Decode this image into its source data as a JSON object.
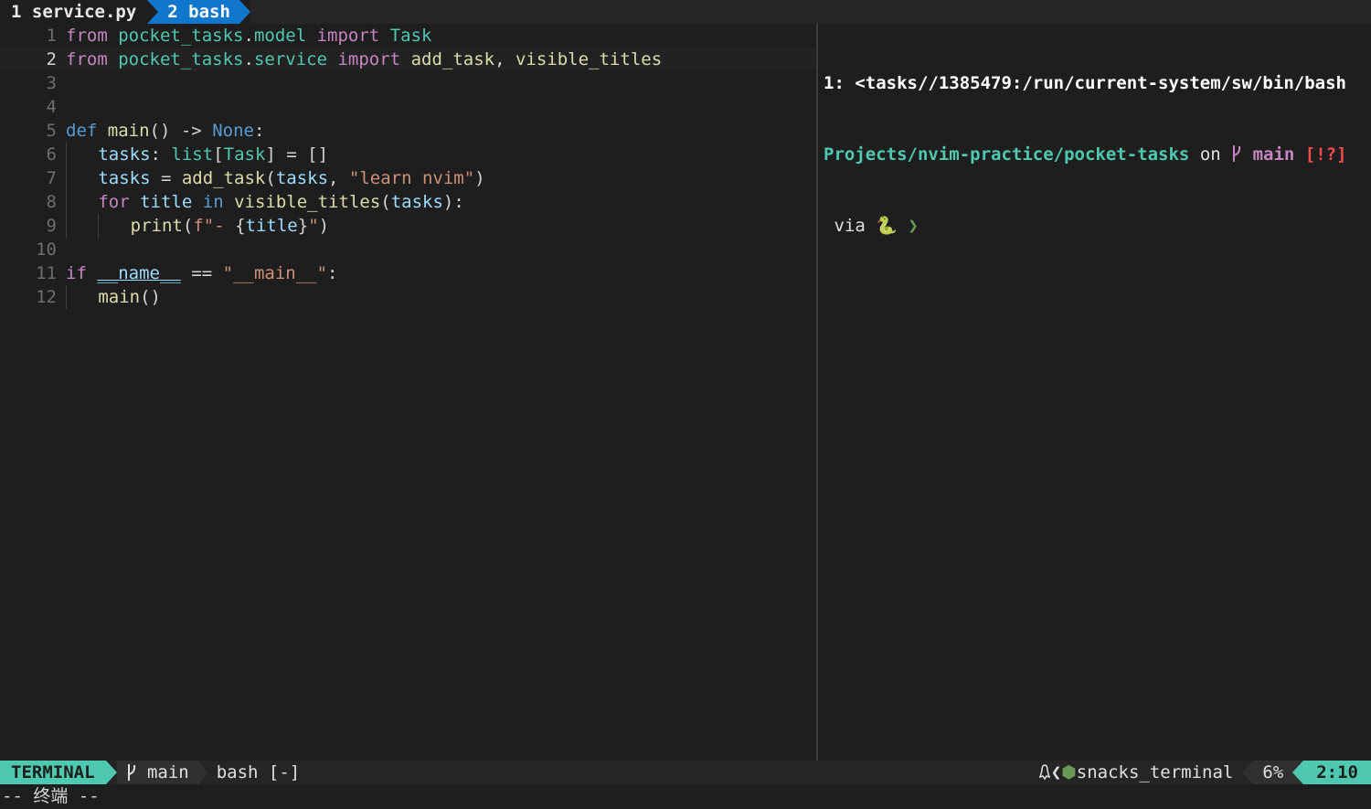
{
  "tabline": {
    "tabs": [
      {
        "label": "1 service.py",
        "active": false
      },
      {
        "label": "2 bash",
        "active": true
      }
    ]
  },
  "editor": {
    "lines": [
      {
        "num": "1"
      },
      {
        "num": "2"
      },
      {
        "num": "3"
      },
      {
        "num": "4"
      },
      {
        "num": "5"
      },
      {
        "num": "6"
      },
      {
        "num": "7"
      },
      {
        "num": "8"
      },
      {
        "num": "9"
      },
      {
        "num": "10"
      },
      {
        "num": "11"
      },
      {
        "num": "12"
      }
    ],
    "tokens": {
      "l1": [
        "from",
        " ",
        "pocket_tasks",
        ".",
        "model",
        " ",
        "import",
        " ",
        "Task"
      ],
      "l2": [
        "from",
        " ",
        "pocket_tasks",
        ".",
        "service",
        " ",
        "import",
        " ",
        "add_task",
        ", ",
        "visible_titles"
      ],
      "l5": [
        "def",
        " ",
        "main",
        "() -> ",
        "None",
        ":"
      ],
      "l6": [
        "tasks",
        ": ",
        "list",
        "[",
        "Task",
        "] = []"
      ],
      "l7": [
        "tasks",
        " = ",
        "add_task",
        "(",
        "tasks",
        ", ",
        "\"learn nvim\"",
        ")"
      ],
      "l8": [
        "for",
        " ",
        "title",
        " ",
        "in",
        " ",
        "visible_titles",
        "(",
        "tasks",
        "):"
      ],
      "l9": [
        "print",
        "(",
        "f\"- ",
        "{",
        "title",
        "}",
        "\"",
        ")"
      ],
      "l11": [
        "if",
        " ",
        "__name__",
        " == ",
        "\"__main__\"",
        ":"
      ],
      "l12": [
        "main",
        "()"
      ]
    }
  },
  "terminal": {
    "title": "1: <tasks//1385479:/run/current-system/sw/bin/bash",
    "path": "Projects/nvim-practice/pocket-tasks",
    "on": " on ",
    "branch_icon": "git-branch-icon",
    "branch": " main",
    "status": " [!?]",
    "via": " via ",
    "python_icon": "🐍",
    "prompt": " ❯"
  },
  "statusline": {
    "mode": "TERMINAL",
    "branch": " main",
    "file": "bash [-]",
    "ft_icons": "linux-icon",
    "ft_name": "snacks_terminal",
    "percent": "6%",
    "position": "2:10"
  },
  "cmdline": {
    "text": "-- 终端 --"
  },
  "colors": {
    "accent": "#4ec9b0",
    "tab_active": "#1177cc",
    "background": "#1e1e1e"
  }
}
